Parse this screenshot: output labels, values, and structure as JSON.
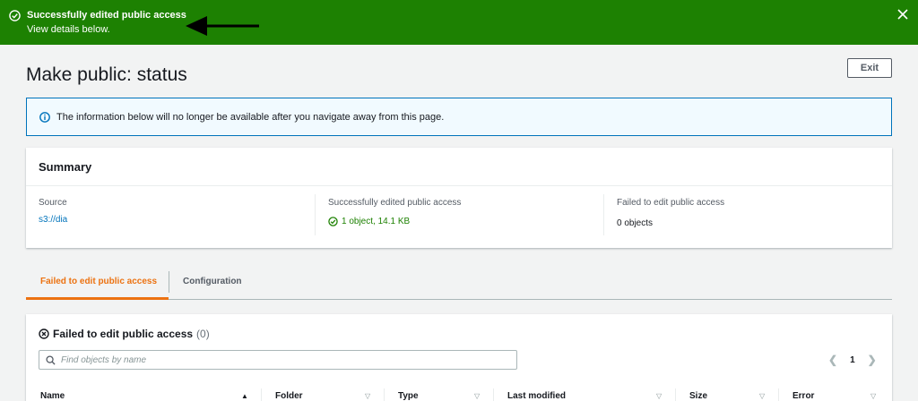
{
  "flash": {
    "title": "Successfully edited public access",
    "subtitle": "View details below."
  },
  "header": {
    "title": "Make public: status",
    "exit_label": "Exit"
  },
  "info": {
    "text": "The information below will no longer be available after you navigate away from this page."
  },
  "summary": {
    "title": "Summary",
    "source_label": "Source",
    "source_value": "s3://dia",
    "success_label": "Successfully edited public access",
    "success_value": "1 object, 14.1 KB",
    "failed_label": "Failed to edit public access",
    "failed_value": "0 objects"
  },
  "tabs": [
    {
      "label": "Failed to edit public access",
      "active": true
    },
    {
      "label": "Configuration",
      "active": false
    }
  ],
  "panel": {
    "title": "Failed to edit public access",
    "count": "(0)",
    "search_placeholder": "Find objects by name",
    "page": "1"
  },
  "table": {
    "columns": [
      "Name",
      "Folder",
      "Type",
      "Last modified",
      "Size",
      "Error"
    ]
  },
  "colors": {
    "success_green": "#1d8102",
    "link_blue": "#0073bb",
    "tab_orange": "#ec7211"
  }
}
